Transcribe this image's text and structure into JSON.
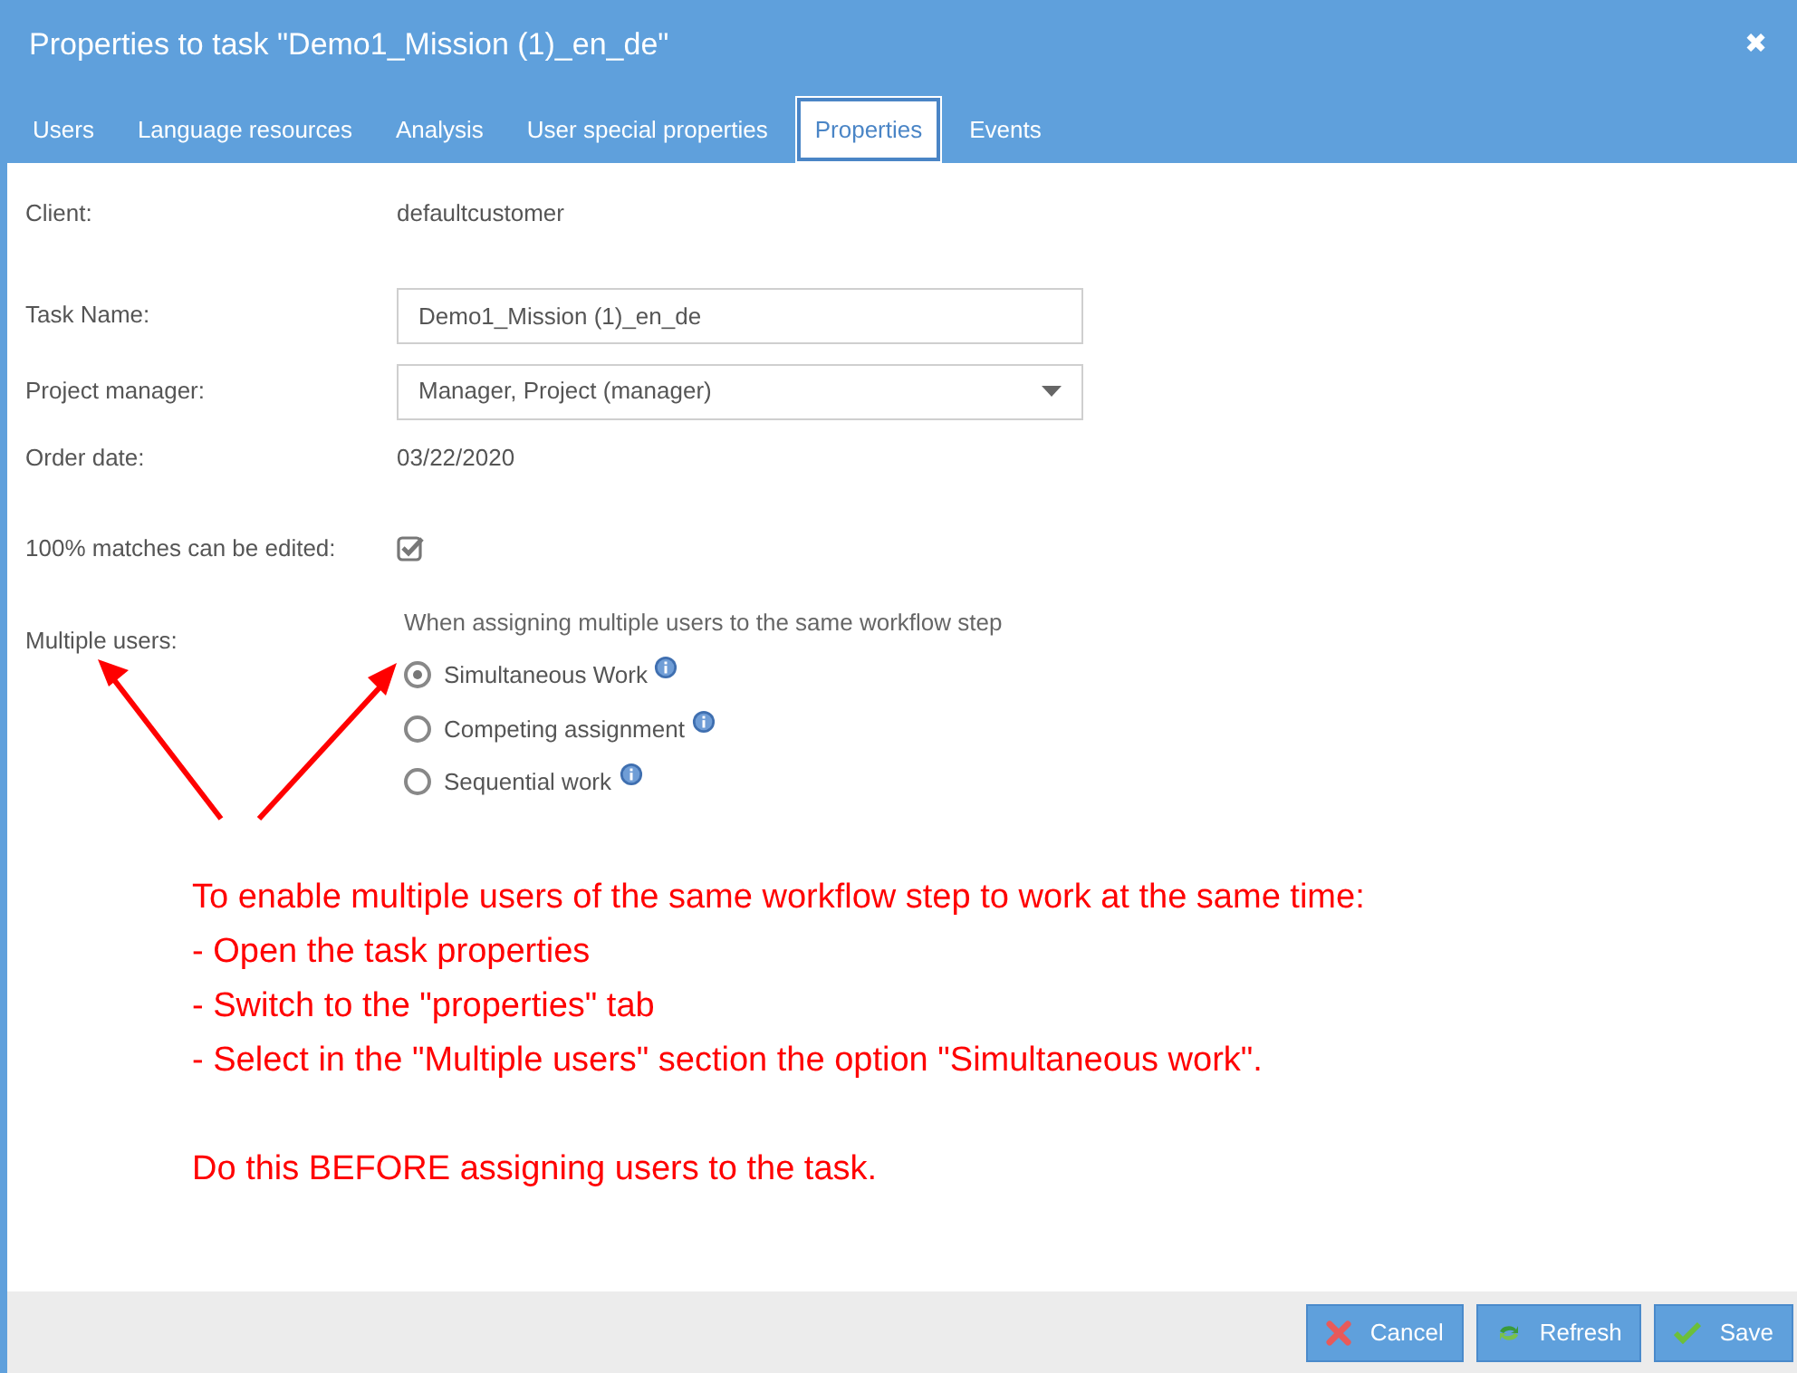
{
  "window": {
    "title": "Properties to task \"Demo1_Mission (1)_en_de\"",
    "close": "✖"
  },
  "tabs": [
    {
      "label": "Users",
      "selected": false
    },
    {
      "label": "Language resources",
      "selected": false
    },
    {
      "label": "Analysis",
      "selected": false
    },
    {
      "label": "User special properties",
      "selected": false
    },
    {
      "label": "Properties",
      "selected": true
    },
    {
      "label": "Events",
      "selected": false
    }
  ],
  "fields": [
    {
      "kind": "text",
      "label": "Client:",
      "value": "defaultcustomer"
    },
    {
      "kind": "input",
      "label": "Task Name:",
      "value": "Demo1_Mission (1)_en_de"
    },
    {
      "kind": "select",
      "label": "Project manager:",
      "value": "Manager, Project (manager)"
    },
    {
      "kind": "text",
      "label": "Order date:",
      "value": "03/22/2020"
    },
    {
      "kind": "checkbox",
      "label": "100% matches can be edited:",
      "checked": true
    }
  ],
  "multiple_users": {
    "label": "Multiple users:",
    "hint": "When assigning multiple users to the same workflow step",
    "options": [
      {
        "label": "Simultaneous Work",
        "selected": true
      },
      {
        "label": "Competing assignment",
        "selected": false
      },
      {
        "label": "Sequential work",
        "selected": false
      }
    ]
  },
  "annotation": {
    "lines": [
      "To enable multiple users of the same workflow step to work at the same time:",
      "- Open the task properties",
      "- Switch to the \"properties\" tab",
      "- Select in the \"Multiple users\" section the option \"Simultaneous work\"."
    ],
    "note": "Do this BEFORE assigning users to the task."
  },
  "buttons": [
    {
      "kind": "cancel",
      "label": "Cancel"
    },
    {
      "kind": "refresh",
      "label": "Refresh"
    },
    {
      "kind": "save",
      "label": "Save"
    }
  ]
}
